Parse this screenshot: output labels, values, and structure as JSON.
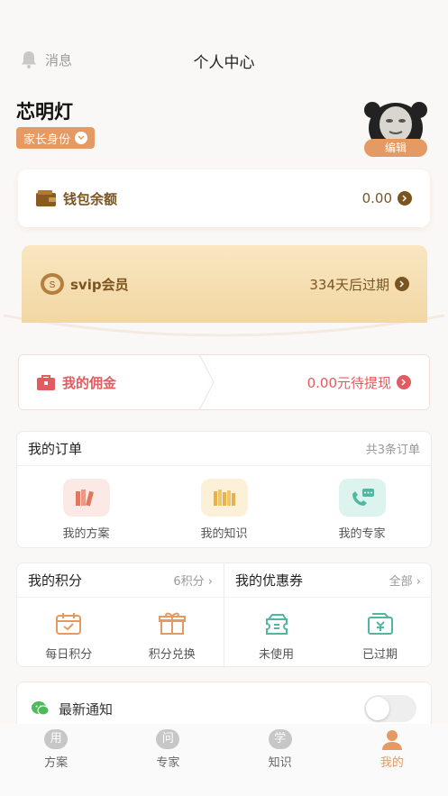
{
  "header": {
    "message_label": "消息",
    "title": "个人中心"
  },
  "profile": {
    "name": "芯明灯",
    "role": "家长身份",
    "edit_label": "编辑"
  },
  "wallet": {
    "label": "钱包余额",
    "value": "0.00"
  },
  "svip": {
    "label": "svip会员",
    "value": "334天后过期"
  },
  "commission": {
    "label": "我的佣金",
    "value": "0.00元待提现"
  },
  "orders": {
    "title": "我的订单",
    "summary": "共3条订单",
    "items": [
      {
        "label": "我的方案",
        "icon": "plan-icon"
      },
      {
        "label": "我的知识",
        "icon": "books-icon"
      },
      {
        "label": "我的专家",
        "icon": "expert-chat-icon"
      }
    ]
  },
  "points": {
    "title": "我的积分",
    "summary": "6积分",
    "items": [
      {
        "label": "每日积分"
      },
      {
        "label": "积分兑换"
      }
    ]
  },
  "coupons": {
    "title": "我的优惠券",
    "summary": "全部",
    "items": [
      {
        "label": "未使用"
      },
      {
        "label": "已过期"
      }
    ]
  },
  "notice": {
    "label": "最新通知",
    "enabled": false
  },
  "tabbar": {
    "tabs": [
      {
        "badge": "用",
        "label": "方案"
      },
      {
        "badge": "问",
        "label": "专家"
      },
      {
        "badge": "学",
        "label": "知识"
      },
      {
        "badge": "",
        "label": "我的",
        "active": true
      }
    ]
  },
  "colors": {
    "accent": "#e59a63",
    "brown": "#7a5520",
    "red": "#e05c60",
    "teal": "#4fb8a0"
  }
}
